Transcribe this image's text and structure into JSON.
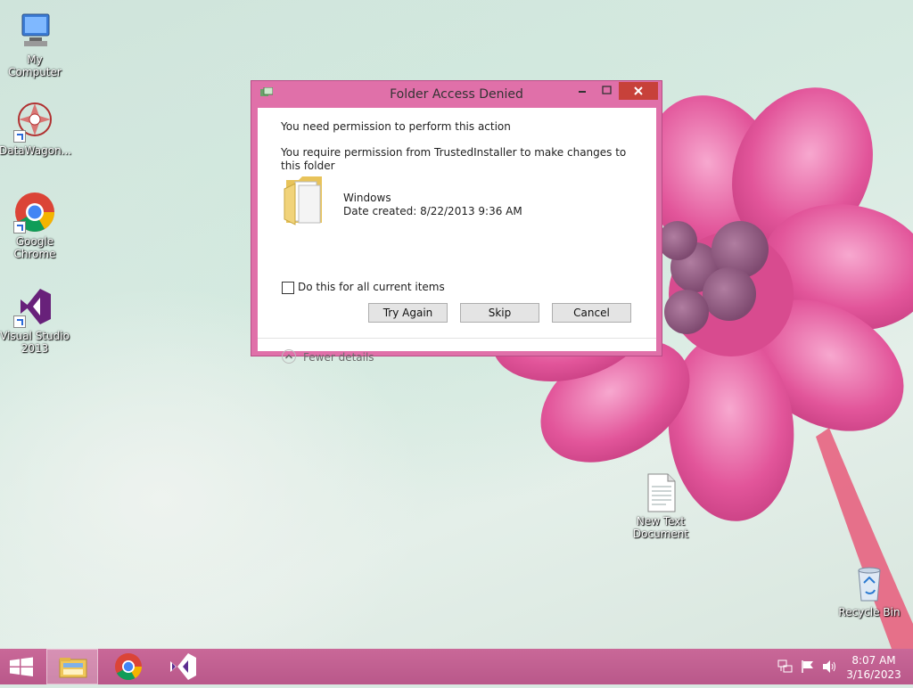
{
  "desktop": {
    "icons": [
      {
        "label": "My Computer"
      },
      {
        "label": "DataWagon..."
      },
      {
        "label": "Google Chrome"
      },
      {
        "label": "Visual Studio 2013"
      },
      {
        "label": "New Text Document"
      },
      {
        "label": "Recycle Bin"
      }
    ]
  },
  "dialog": {
    "title": "Folder Access Denied",
    "heading": "You need permission to perform this action",
    "message": "You require permission from TrustedInstaller to make changes to this folder",
    "item_name": "Windows",
    "item_date": "Date created: 8/22/2013 9:36 AM",
    "checkbox_label": "Do this for all current items",
    "checkbox_checked": false,
    "buttons": {
      "try_again": "Try Again",
      "skip": "Skip",
      "cancel": "Cancel"
    },
    "fewer_details": "Fewer details"
  },
  "taskbar": {
    "items": [
      "start-button",
      "file-explorer",
      "google-chrome",
      "visual-studio"
    ],
    "clock": {
      "time": "8:07 AM",
      "date": "3/16/2023"
    }
  },
  "colors": {
    "window_frame": "#e070a9",
    "close_button": "#c7413a",
    "taskbar": "#c4608f"
  }
}
